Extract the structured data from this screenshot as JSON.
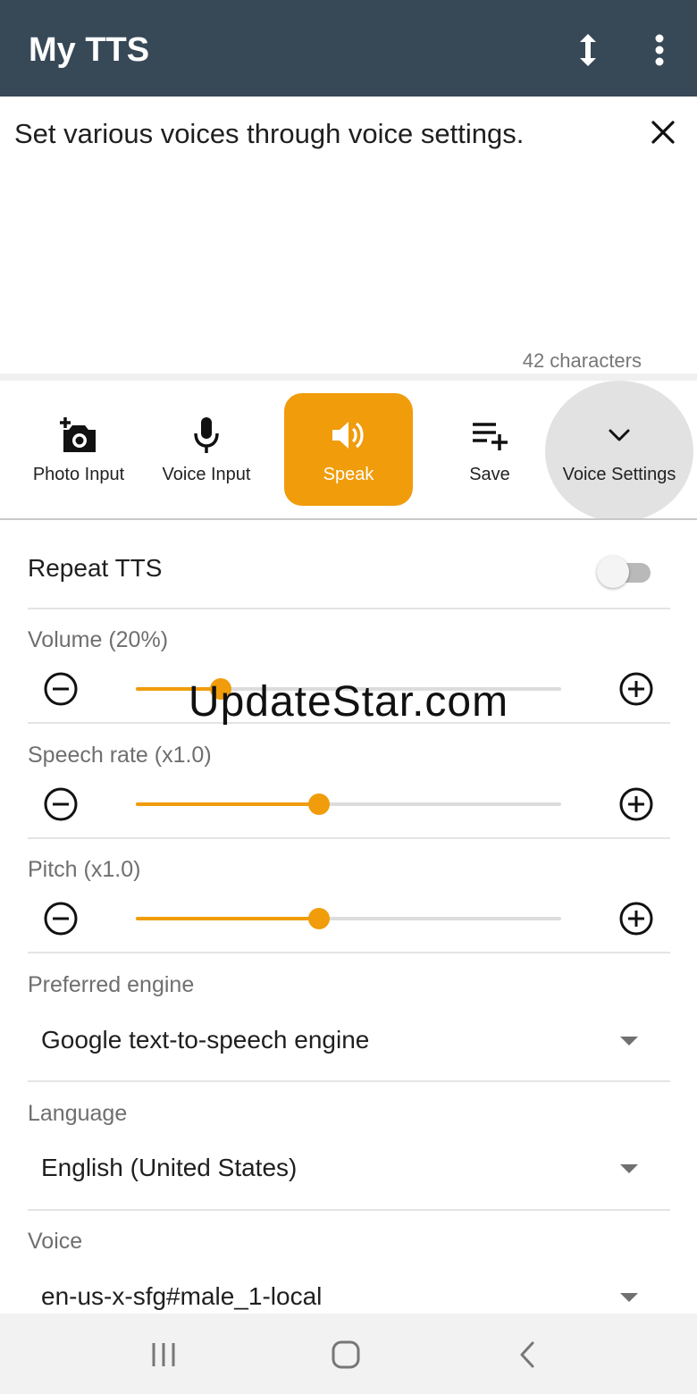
{
  "app": {
    "title": "My TTS"
  },
  "appbar": {
    "icons": [
      "vertical-resize-icon",
      "more-vert-icon"
    ]
  },
  "editor": {
    "text": "Set various voices through voice settings.",
    "char_count": "42 characters"
  },
  "actions": [
    {
      "label": "Photo Input",
      "icon": "add-photo-icon"
    },
    {
      "label": "Voice Input",
      "icon": "mic-icon"
    },
    {
      "label": "Speak",
      "icon": "volume-icon"
    },
    {
      "label": "Save",
      "icon": "playlist-add-icon"
    },
    {
      "label": "Voice Settings",
      "icon": "chevron-down-icon"
    }
  ],
  "settings": {
    "repeat": {
      "label": "Repeat TTS",
      "enabled": false
    },
    "volume": {
      "label": "Volume (20%)",
      "value": 0.2
    },
    "speech_rate": {
      "label": "Speech rate (x1.0)",
      "value": 0.43
    },
    "pitch": {
      "label": "Pitch (x1.0)",
      "value": 0.43
    },
    "engine": {
      "label": "Preferred engine",
      "value": "Google text-to-speech engine"
    },
    "language": {
      "label": "Language",
      "value": "English (United States)"
    },
    "voice": {
      "label": "Voice",
      "value": "en-us-x-sfg#male_1-local"
    }
  },
  "watermark": "UpdateStar.com",
  "colors": {
    "appbar": "#374857",
    "accent": "#f09c0b"
  },
  "navbar": {
    "icons": [
      "recent-apps-icon",
      "home-icon",
      "back-icon"
    ]
  }
}
